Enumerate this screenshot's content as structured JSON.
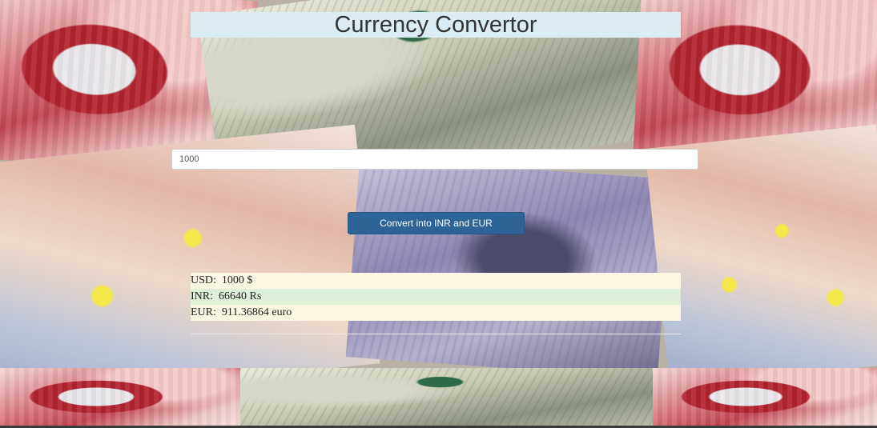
{
  "app": {
    "title": "Currency Convertor"
  },
  "form": {
    "amount_value": "1000",
    "convert_label": "Convert into INR and EUR"
  },
  "results": {
    "usd_label": "USD:",
    "usd_value": "1000 $",
    "inr_label": "INR:",
    "inr_value": "66640 Rs",
    "eur_label": "EUR:",
    "eur_value": "911.36864 euro"
  },
  "theme": {
    "title_bg": "#dbecf5",
    "button_bg": "#2d6396",
    "usd_row_bg": "#fcf6e3",
    "inr_row_bg": "#dff0d8",
    "eur_row_bg": "#fcf6e3"
  }
}
